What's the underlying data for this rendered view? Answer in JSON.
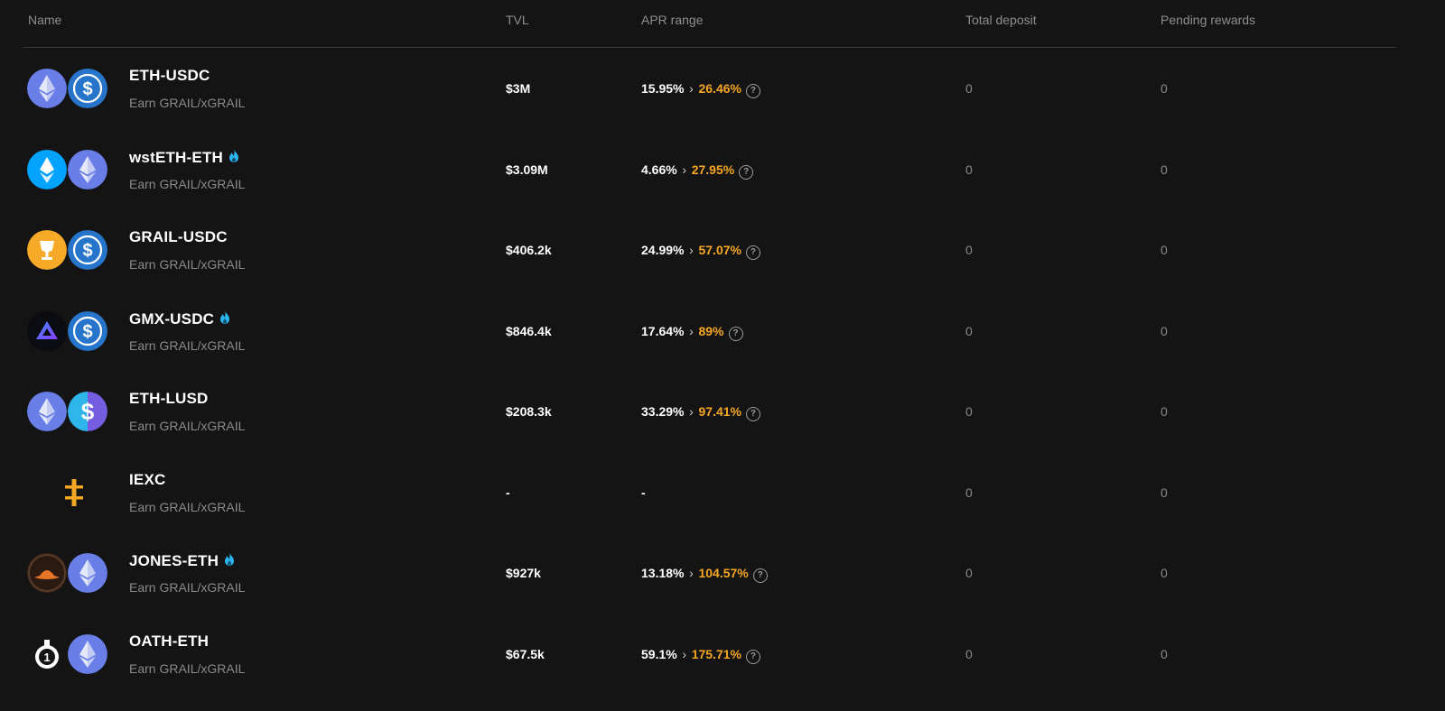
{
  "header": {
    "name": "Name",
    "tvl": "TVL",
    "apr": "APR range",
    "deposit": "Total deposit",
    "pending": "Pending rewards"
  },
  "colors": {
    "background": "#141414",
    "accent_apr": "#f5a623",
    "fire": "#2bb6f0",
    "muted": "#8a8a8a"
  },
  "rows": [
    {
      "name": "ETH-USDC",
      "earn": "Earn GRAIL/xGRAIL",
      "tvl": "$3M",
      "apr_min": "15.95%",
      "apr_max": "26.46%",
      "deposit": "0",
      "pending": "0",
      "hot": false,
      "icons": [
        "eth-icon",
        "usdc-icon"
      ]
    },
    {
      "name": "wstETH-ETH",
      "earn": "Earn GRAIL/xGRAIL",
      "tvl": "$3.09M",
      "apr_min": "4.66%",
      "apr_max": "27.95%",
      "deposit": "0",
      "pending": "0",
      "hot": true,
      "icons": [
        "wsteth-icon",
        "eth-icon"
      ]
    },
    {
      "name": "GRAIL-USDC",
      "earn": "Earn GRAIL/xGRAIL",
      "tvl": "$406.2k",
      "apr_min": "24.99%",
      "apr_max": "57.07%",
      "deposit": "0",
      "pending": "0",
      "hot": false,
      "icons": [
        "grail-icon",
        "usdc-icon"
      ]
    },
    {
      "name": "GMX-USDC",
      "earn": "Earn GRAIL/xGRAIL",
      "tvl": "$846.4k",
      "apr_min": "17.64%",
      "apr_max": "89%",
      "deposit": "0",
      "pending": "0",
      "hot": true,
      "icons": [
        "gmx-icon",
        "usdc-icon"
      ]
    },
    {
      "name": "ETH-LUSD",
      "earn": "Earn GRAIL/xGRAIL",
      "tvl": "$208.3k",
      "apr_min": "33.29%",
      "apr_max": "97.41%",
      "deposit": "0",
      "pending": "0",
      "hot": false,
      "icons": [
        "eth-icon",
        "lusd-icon"
      ]
    },
    {
      "name": "IEXC",
      "earn": "Earn GRAIL/xGRAIL",
      "tvl": "-",
      "apr_min": "-",
      "apr_max": "",
      "deposit": "0",
      "pending": "0",
      "hot": false,
      "icons": [
        "iexc-icon"
      ]
    },
    {
      "name": "JONES-ETH",
      "earn": "Earn GRAIL/xGRAIL",
      "tvl": "$927k",
      "apr_min": "13.18%",
      "apr_max": "104.57%",
      "deposit": "0",
      "pending": "0",
      "hot": true,
      "icons": [
        "jones-icon",
        "eth-icon"
      ]
    },
    {
      "name": "OATH-ETH",
      "earn": "Earn GRAIL/xGRAIL",
      "tvl": "$67.5k",
      "apr_min": "59.1%",
      "apr_max": "175.71%",
      "deposit": "0",
      "pending": "0",
      "hot": false,
      "icons": [
        "oath-icon",
        "eth-icon"
      ]
    }
  ]
}
